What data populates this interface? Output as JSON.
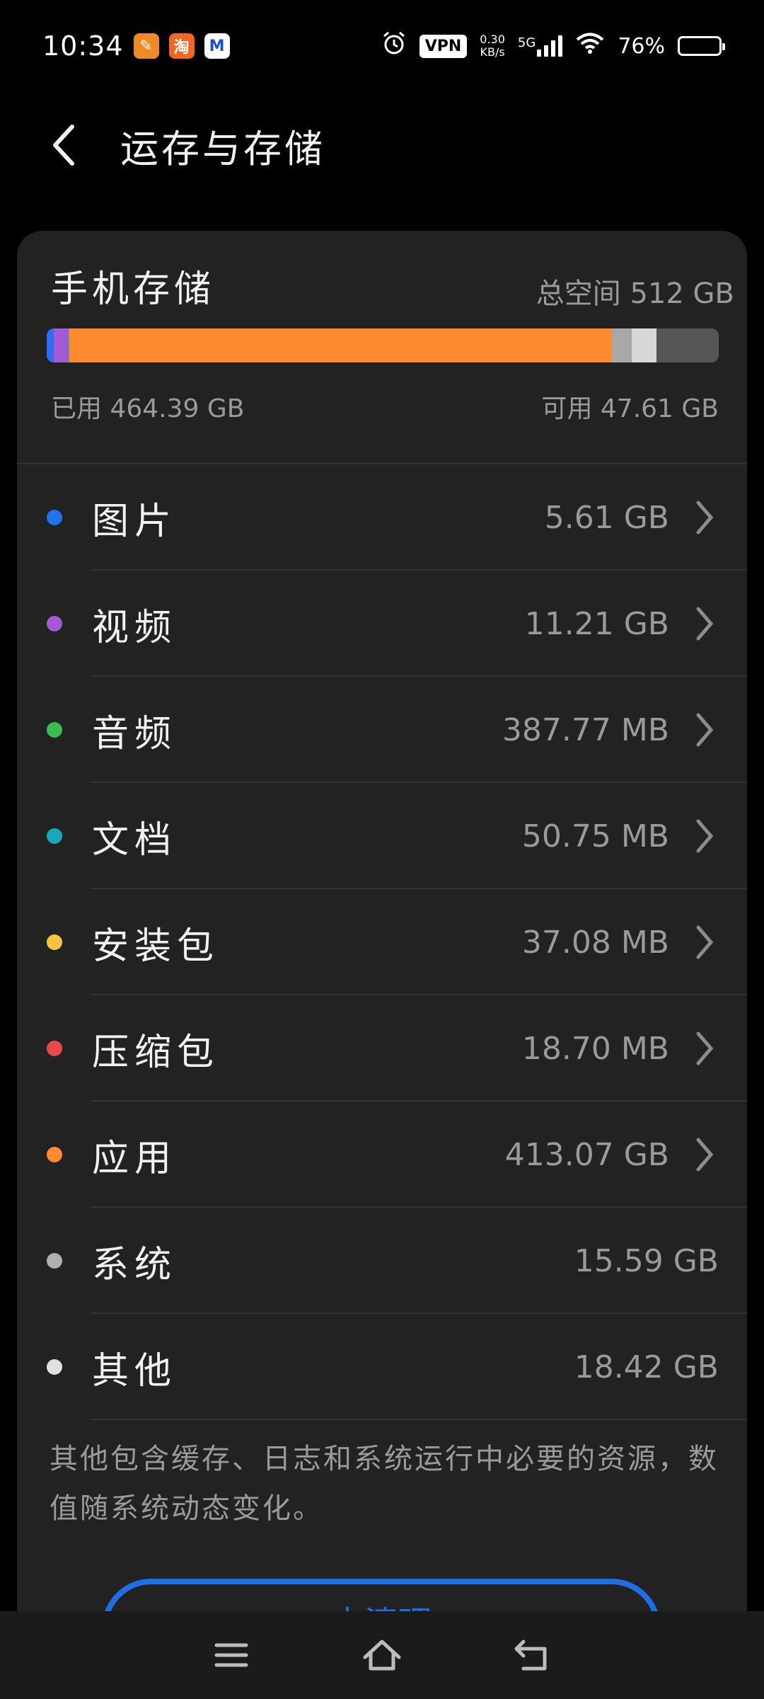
{
  "status_bar": {
    "time": "10:34",
    "app_badges": [
      {
        "icon": "yellow-app-icon",
        "glyph": "✎",
        "color": "#f08a24"
      },
      {
        "icon": "taobao-icon",
        "glyph": "淘",
        "color": "#f26522"
      },
      {
        "icon": "mail-icon",
        "glyph": "M",
        "color": "#ffffff"
      }
    ],
    "vpn": "VPN",
    "net_speed_value": "0.30",
    "net_speed_unit": "KB/s",
    "network": "5G",
    "battery": "76%",
    "battery_level": 0.76
  },
  "header": {
    "title": "运存与存储"
  },
  "storage": {
    "title": "手机存储",
    "total": "总空间 512 GB",
    "used": "已用 464.39 GB",
    "free": "可用 47.61 GB",
    "bar_segments": [
      {
        "name": "图片",
        "fraction": 0.011,
        "color": "#2f6df5"
      },
      {
        "name": "视频",
        "fraction": 0.022,
        "color": "#a45ad8"
      },
      {
        "name": "音频",
        "fraction": 0.001,
        "color": "#3dbb4f"
      },
      {
        "name": "应用",
        "fraction": 0.807,
        "color": "#ff8a30"
      },
      {
        "name": "系统",
        "fraction": 0.03,
        "color": "#a8a8a8"
      },
      {
        "name": "其他",
        "fraction": 0.036,
        "color": "#d8d8d8"
      }
    ]
  },
  "categories": [
    {
      "label": "图片",
      "size": "5.61 GB",
      "color": "#1f72f0",
      "chevron": true
    },
    {
      "label": "视频",
      "size": "11.21 GB",
      "color": "#a45ad8",
      "chevron": true
    },
    {
      "label": "音频",
      "size": "387.77 MB",
      "color": "#3dbb4f",
      "chevron": true
    },
    {
      "label": "文档",
      "size": "50.75 MB",
      "color": "#1aa8b8",
      "chevron": true
    },
    {
      "label": "安装包",
      "size": "37.08 MB",
      "color": "#f5c542",
      "chevron": true
    },
    {
      "label": "压缩包",
      "size": "18.70 MB",
      "color": "#e84a4a",
      "chevron": true
    },
    {
      "label": "应用",
      "size": "413.07 GB",
      "color": "#ff8a30",
      "chevron": true
    },
    {
      "label": "系统",
      "size": "15.59 GB",
      "color": "#b0b0b0",
      "chevron": false
    },
    {
      "label": "其他",
      "size": "18.42 GB",
      "color": "#e0e0e0",
      "chevron": false
    }
  ],
  "note": "其他包含缓存、日志和系统运行中必要的资源，数值随系统动态变化。",
  "clean_button": {
    "label": "去清理"
  },
  "nav": {
    "menu_icon": "menu-icon",
    "home_icon": "home-icon",
    "back_icon": "back-arrow-icon"
  }
}
